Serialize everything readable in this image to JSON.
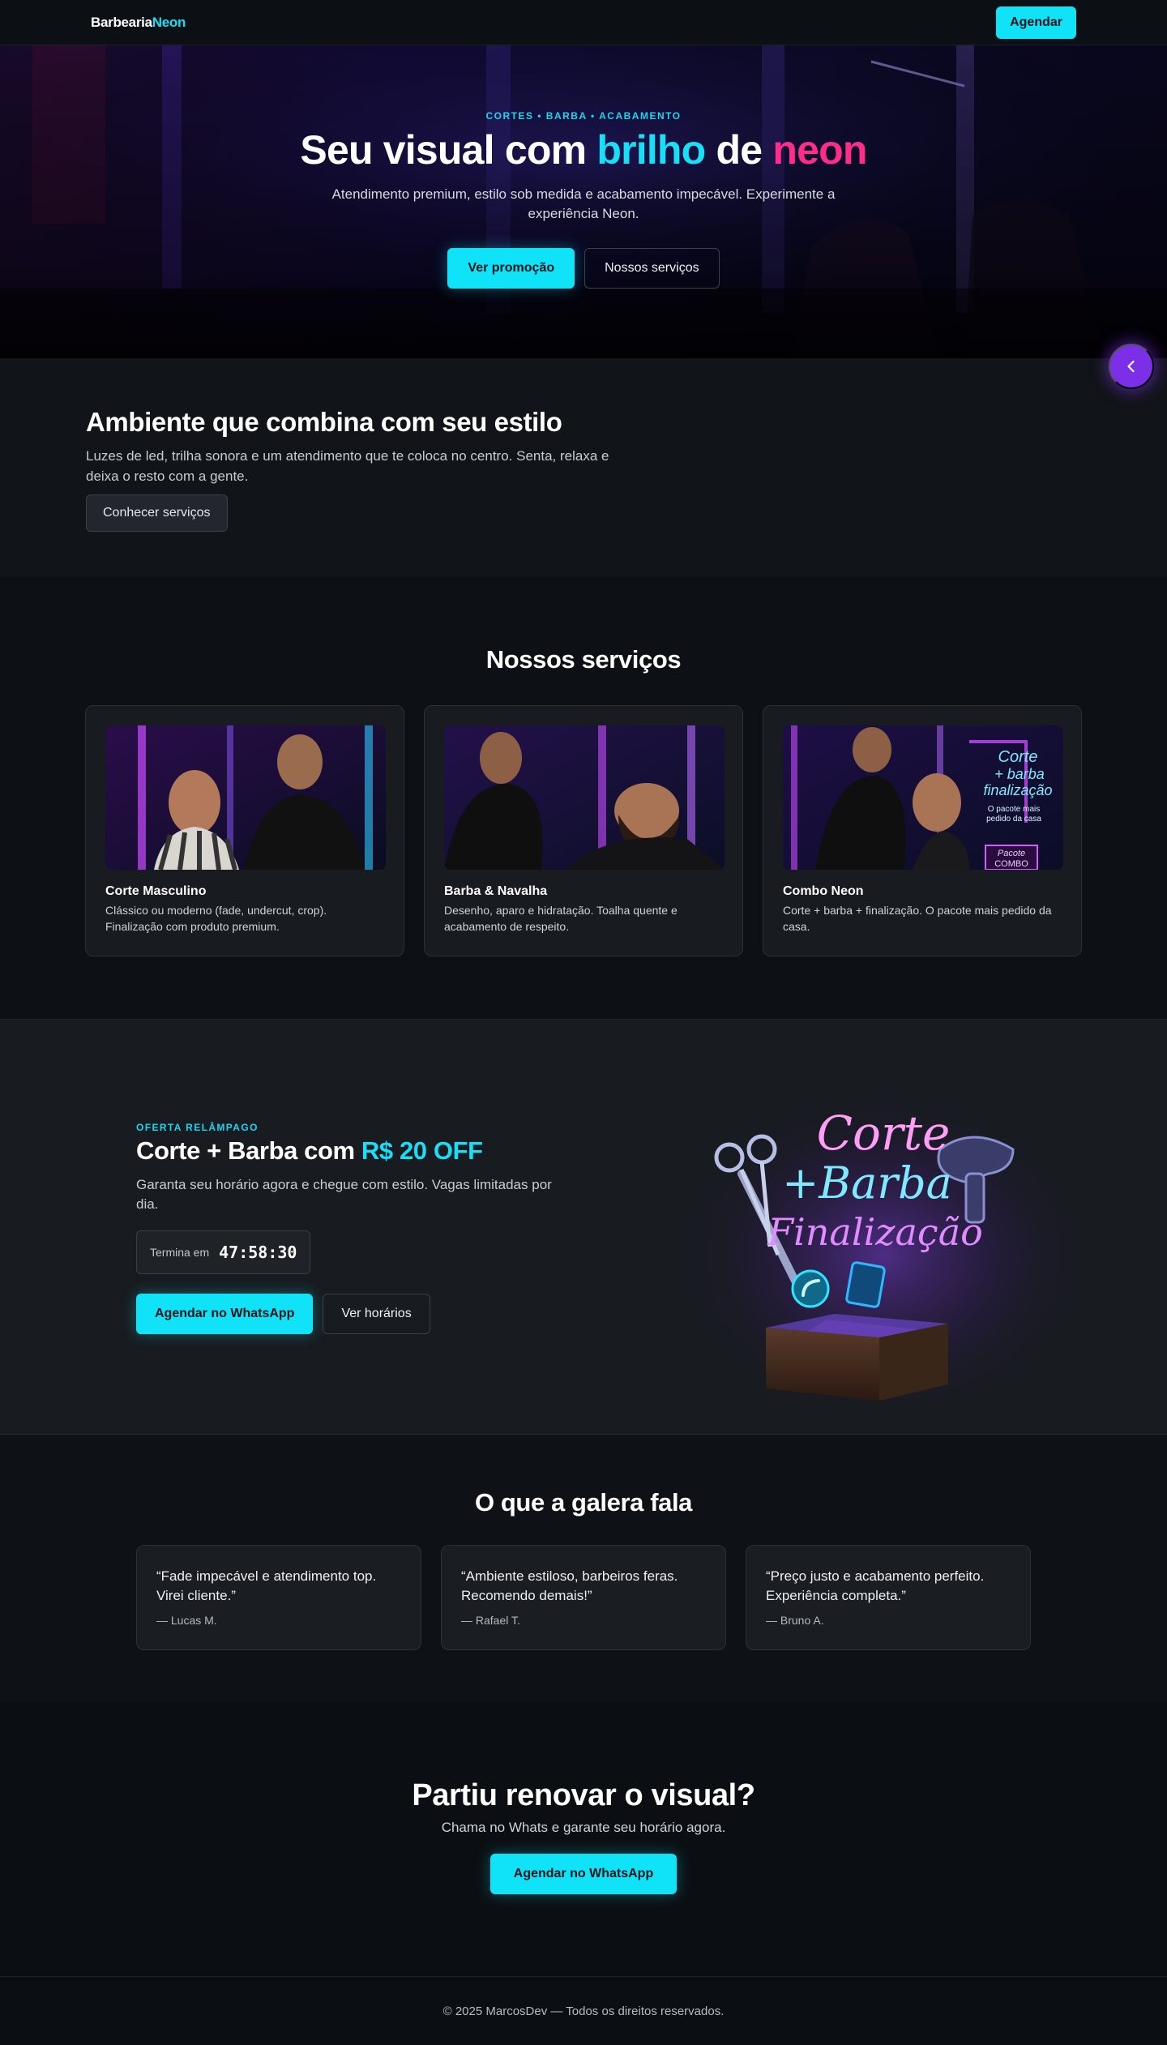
{
  "nav": {
    "brand_a": "Barbearia",
    "brand_b": "Neon",
    "cta": "Agendar"
  },
  "hero": {
    "kicker": "CORTES • BARBA • ACABAMENTO",
    "title_a": "Seu visual com ",
    "title_b": "brilho",
    "title_c": " de ",
    "title_d": "neon",
    "subtitle": "Atendimento premium, estilo sob medida e acabamento impecável. Experimente a experiência Neon.",
    "primary": "Ver promoção",
    "secondary": "Nossos serviços"
  },
  "fab": {
    "icon": "chevron-left-icon"
  },
  "ambiente": {
    "title": "Ambiente que combina com seu estilo",
    "text": "Luzes de led, trilha sonora e um atendimento que te coloca no centro. Senta, relaxa e deixa o resto com a gente.",
    "button": "Conhecer serviços"
  },
  "services": {
    "title": "Nossos serviços",
    "items": [
      {
        "name": "Corte Masculino",
        "desc": "Clássico ou moderno (fade, undercut, crop). Finalização com produto premium."
      },
      {
        "name": "Barba & Navalha",
        "desc": "Desenho, aparo e hidratação. Toalha quente e acabamento de respeito."
      },
      {
        "name": "Combo Neon",
        "desc": "Corte + barba + finalização. O pacote mais pedido da casa."
      }
    ],
    "combo_sign": {
      "l1": "Corte",
      "l2": "+ barba",
      "l3": "finalização",
      "l4": "O pacote mais",
      "l5": "pedido da casa",
      "box1": "Pacote",
      "box2": "COMBO"
    }
  },
  "offer": {
    "kicker": "OFERTA RELÂMPAGO",
    "title_a": "Corte + Barba com ",
    "title_b": "R$ 20 OFF",
    "text": "Garanta seu horário agora e chegue com estilo. Vagas limitadas por dia.",
    "timer_label": "Termina em",
    "timer_value": "47:58:30",
    "primary": "Agendar no WhatsApp",
    "secondary": "Ver horários",
    "art": {
      "l1": "Corte",
      "l2": "+Barba",
      "l3": "Finalização"
    }
  },
  "testimonials": {
    "title": "O que a galera fala",
    "items": [
      {
        "quote": "“Fade impecável e atendimento top. Virei cliente.”",
        "author": "— Lucas M."
      },
      {
        "quote": "“Ambiente estiloso, barbeiros feras. Recomendo demais!”",
        "author": "— Rafael T."
      },
      {
        "quote": "“Preço justo e acabamento perfeito. Experiência completa.”",
        "author": "— Bruno A."
      }
    ]
  },
  "cta": {
    "title": "Partiu renovar o visual?",
    "text": "Chama no Whats e garante seu horário agora.",
    "button": "Agendar no WhatsApp"
  },
  "footer": {
    "text": "© 2025 MarcosDev — Todos os direitos reservados."
  },
  "colors": {
    "accent": "#10e3f7",
    "pink": "#ff2d8a",
    "purple": "#7b2fe6",
    "bg": "#0b0e12"
  }
}
